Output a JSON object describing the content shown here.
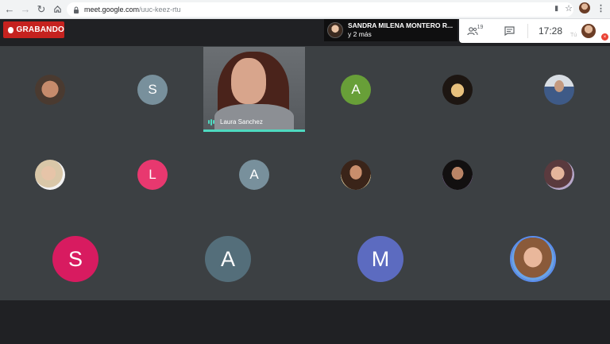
{
  "browser": {
    "url_host": "meet.google.com",
    "url_path": "/uuc-keez-rtu"
  },
  "meeting": {
    "recording_label": "GRABANDO",
    "presenter": {
      "name": "SANDRA MILENA MONTERO R...",
      "others": "y 2 más"
    },
    "people_count": "19",
    "time": "17:28",
    "self_label": "Tú",
    "featured": {
      "name": "Laura Sanchez"
    }
  },
  "colors": {
    "recording": "#c5221f",
    "speaking_accent": "#4ed9c0",
    "grid_background": "#3c4043"
  },
  "participants_row1": [
    {
      "type": "photo",
      "icon": "man-glasses-photo"
    },
    {
      "type": "letter",
      "letter": "S",
      "color": "#78909c"
    },
    {
      "type": "letter",
      "letter": "A",
      "color": "#689f38"
    },
    {
      "type": "photo",
      "icon": "woman-photo"
    },
    {
      "type": "photo",
      "icon": "man-photo"
    }
  ],
  "participants_row2": [
    {
      "type": "photo",
      "icon": "woman-light-hair-photo"
    },
    {
      "type": "letter",
      "letter": "L",
      "color": "#e8386f"
    },
    {
      "type": "letter",
      "letter": "A",
      "color": "#78909c"
    },
    {
      "type": "photo",
      "icon": "woman-photo"
    },
    {
      "type": "photo",
      "icon": "woman-photo"
    },
    {
      "type": "photo",
      "icon": "woman-photo"
    }
  ],
  "participants_row3": [
    {
      "type": "letter",
      "letter": "S",
      "color": "#d81b60"
    },
    {
      "type": "letter",
      "letter": "A",
      "color": "#546e7a"
    },
    {
      "type": "letter",
      "letter": "M",
      "color": "#5c6bc0"
    },
    {
      "type": "photo",
      "icon": "woman-blonde-photo"
    }
  ]
}
